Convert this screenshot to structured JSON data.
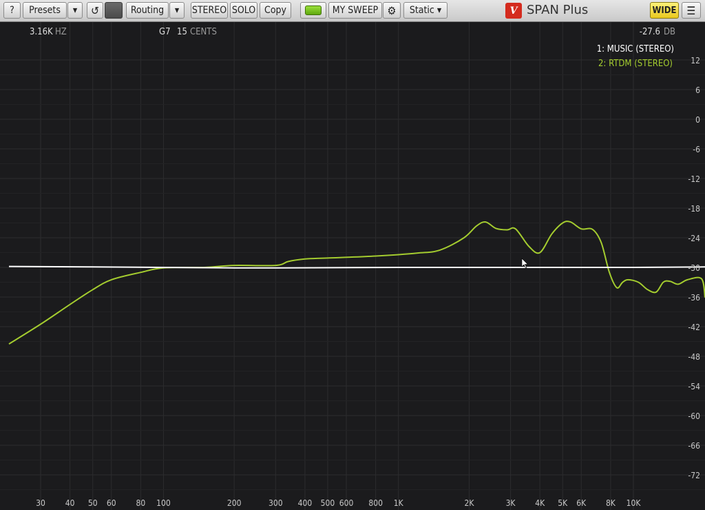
{
  "toolbar": {
    "help_label": "?",
    "presets_label": "Presets",
    "dropdown_glyph": "▾",
    "undo_glyph": "↺",
    "routing_label": "Routing",
    "stereo_label": "STEREO",
    "solo_label": "SOLO",
    "copy_label": "Copy",
    "sweep_label": "MY SWEEP",
    "gear_glyph": "⚙",
    "static_label": "Static ▾",
    "logo_glyph": "V",
    "product_label": "SPAN Plus",
    "wide_label": "WIDE",
    "menu_glyph": "☰"
  },
  "readout": {
    "freq_value": "3.16K",
    "freq_unit": "HZ",
    "note": "G7",
    "cents_value": "15",
    "cents_unit": "CENTS",
    "db_value": "-27.6",
    "db_unit": "DB"
  },
  "legend": [
    {
      "label": "1: MUSIC (STEREO)",
      "color": "#ffffff"
    },
    {
      "label": "2: RTDM (STEREO)",
      "color": "#a4cc2f"
    }
  ],
  "colors": {
    "background": "#1b1b1d",
    "grid": "#2c2c2e",
    "series1": "#ffffff",
    "series2": "#a4cc2f",
    "tick": "#c8c8c8"
  },
  "chart_data": {
    "type": "line",
    "x_scale": "log",
    "xlim": [
      22,
      22000
    ],
    "ylim": [
      -78,
      18
    ],
    "y_ticks": [
      12,
      6,
      0,
      -6,
      -12,
      -18,
      -24,
      -30,
      -36,
      -42,
      -48,
      -54,
      -60,
      -66,
      -72
    ],
    "x_ticks": [
      {
        "value": 30,
        "label": "30"
      },
      {
        "value": 40,
        "label": "40"
      },
      {
        "value": 50,
        "label": "50"
      },
      {
        "value": 60,
        "label": "60"
      },
      {
        "value": 80,
        "label": "80"
      },
      {
        "value": 100,
        "label": "100"
      },
      {
        "value": 200,
        "label": "200"
      },
      {
        "value": 300,
        "label": "300"
      },
      {
        "value": 400,
        "label": "400"
      },
      {
        "value": 500,
        "label": "500"
      },
      {
        "value": 600,
        "label": "600"
      },
      {
        "value": 800,
        "label": "800"
      },
      {
        "value": 1000,
        "label": "1K"
      },
      {
        "value": 2000,
        "label": "2K"
      },
      {
        "value": 3000,
        "label": "3K"
      },
      {
        "value": 4000,
        "label": "4K"
      },
      {
        "value": 5000,
        "label": "5K"
      },
      {
        "value": 6000,
        "label": "6K"
      },
      {
        "value": 8000,
        "label": "8K"
      },
      {
        "value": 10000,
        "label": "10K"
      }
    ],
    "series": [
      {
        "name": "1: MUSIC (STEREO)",
        "x": [
          22,
          100,
          200,
          300,
          1000,
          3000,
          10000,
          22000
        ],
        "y": [
          -29.8,
          -30,
          -30.1,
          -30.1,
          -30,
          -30,
          -30,
          -29.9
        ]
      },
      {
        "name": "2: RTDM (STEREO)",
        "x": [
          22,
          30,
          40,
          50,
          60,
          80,
          100,
          150,
          200,
          300,
          340,
          400,
          500,
          800,
          1200,
          1500,
          1900,
          2150,
          2350,
          2600,
          2900,
          3150,
          3600,
          4000,
          4500,
          5000,
          5400,
          6000,
          6700,
          7300,
          7900,
          8500,
          9000,
          9500,
          10500,
          11500,
          12500,
          13400,
          14300,
          15500,
          17000,
          19500,
          22000
        ],
        "y": [
          -45.5,
          -41.5,
          -37.5,
          -34.5,
          -32.5,
          -31,
          -30.1,
          -30,
          -29.6,
          -29.6,
          -28.8,
          -28.3,
          -28.1,
          -27.7,
          -27.1,
          -26.5,
          -24,
          -21.6,
          -20.8,
          -22.1,
          -22.4,
          -22.2,
          -25.8,
          -27,
          -23.2,
          -21,
          -20.8,
          -22.2,
          -22.3,
          -25,
          -31,
          -34.1,
          -33,
          -32.5,
          -33,
          -34.5,
          -35,
          -33,
          -32.8,
          -33.4,
          -32.5,
          -32.3,
          -36.1
        ]
      }
    ],
    "grid": true,
    "legend_position": "top-right"
  }
}
